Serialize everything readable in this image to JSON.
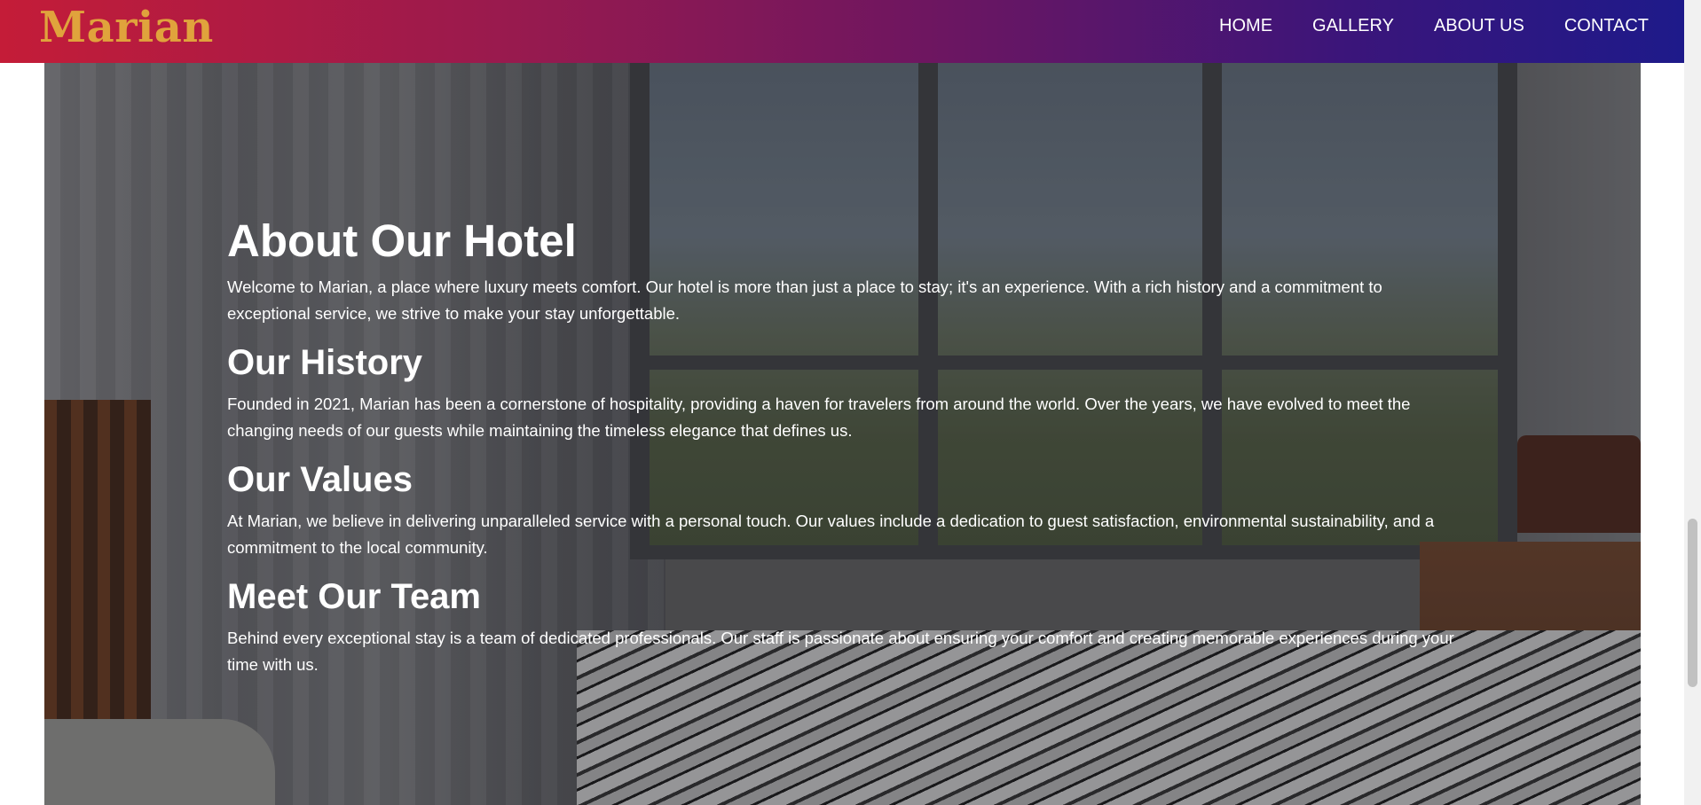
{
  "brand": {
    "logo_text": "Marian"
  },
  "nav": {
    "items": [
      {
        "label": "HOME"
      },
      {
        "label": "GALLERY"
      },
      {
        "label": "ABOUT US"
      },
      {
        "label": "CONTACT"
      }
    ]
  },
  "about": {
    "title": "About Our Hotel",
    "intro": "Welcome to Marian, a place where luxury meets comfort. Our hotel is more than just a place to stay; it's an experience. With a rich history and a commitment to exceptional service, we strive to make your stay unforgettable.",
    "sections": [
      {
        "heading": "Our History",
        "body": "Founded in 2021, Marian has been a cornerstone of hospitality, providing a haven for travelers from around the world. Over the years, we have evolved to meet the changing needs of our guests while maintaining the timeless elegance that defines us."
      },
      {
        "heading": "Our Values",
        "body": "At Marian, we believe in delivering unparalleled service with a personal touch. Our values include a dedication to guest satisfaction, environmental sustainability, and a commitment to the local community."
      },
      {
        "heading": "Meet Our Team",
        "body": "Behind every exceptional stay is a team of dedicated professionals. Our staff is passionate about ensuring your comfort and creating memorable experiences during your time with us."
      }
    ]
  },
  "colors": {
    "nav_gradient_start": "#c41c38",
    "nav_gradient_end": "#1e1a8a",
    "logo": "#e0a33c",
    "text": "#ffffff"
  }
}
